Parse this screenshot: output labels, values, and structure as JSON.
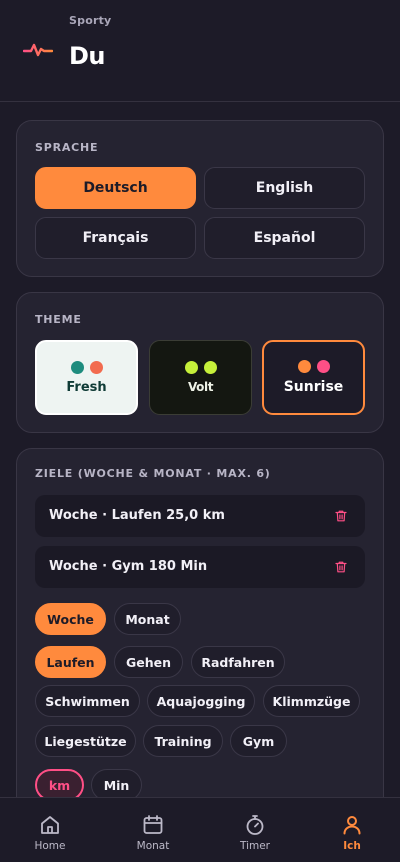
{
  "app": {
    "name": "Sporty",
    "page_title": "Du"
  },
  "language": {
    "section_title": "SPRACHE",
    "options": [
      "Deutsch",
      "English",
      "Français",
      "Español"
    ],
    "selected": "Deutsch"
  },
  "theme": {
    "section_title": "THEME",
    "options": [
      {
        "label": "Fresh",
        "colors": [
          "#1e8c7e",
          "#f26b4f"
        ]
      },
      {
        "label": "Volt",
        "colors": [
          "#c6f03a",
          "#c6f03a"
        ]
      },
      {
        "label": "Sunrise",
        "colors": [
          "#ff8a3d",
          "#ff4f86"
        ]
      }
    ],
    "selected": "Sunrise"
  },
  "goals": {
    "section_title": "ZIELE (WOCHE & MONAT · MAX. 6)",
    "items": [
      {
        "label": "Woche · Laufen 25,0 km"
      },
      {
        "label": "Woche · Gym 180 Min"
      }
    ],
    "period_options": [
      "Woche",
      "Monat"
    ],
    "period_selected": "Woche",
    "activity_options": [
      "Laufen",
      "Gehen",
      "Radfahren",
      "Schwimmen",
      "Aquajogging",
      "Klimmzüge",
      "Liegestütze",
      "Training",
      "Gym"
    ],
    "activity_selected": "Laufen",
    "unit_options": [
      "km",
      "Min"
    ],
    "unit_selected": "km"
  },
  "tabbar": {
    "items": [
      {
        "label": "Home",
        "icon": "home-icon"
      },
      {
        "label": "Monat",
        "icon": "calendar-icon"
      },
      {
        "label": "Timer",
        "icon": "stopwatch-icon"
      },
      {
        "label": "Ich",
        "icon": "person-icon"
      }
    ],
    "active": "Ich"
  },
  "colors": {
    "accent": "#ff8a3d",
    "accent_pink": "#ff4f86",
    "background": "#1d1b28",
    "card": "#252331"
  }
}
